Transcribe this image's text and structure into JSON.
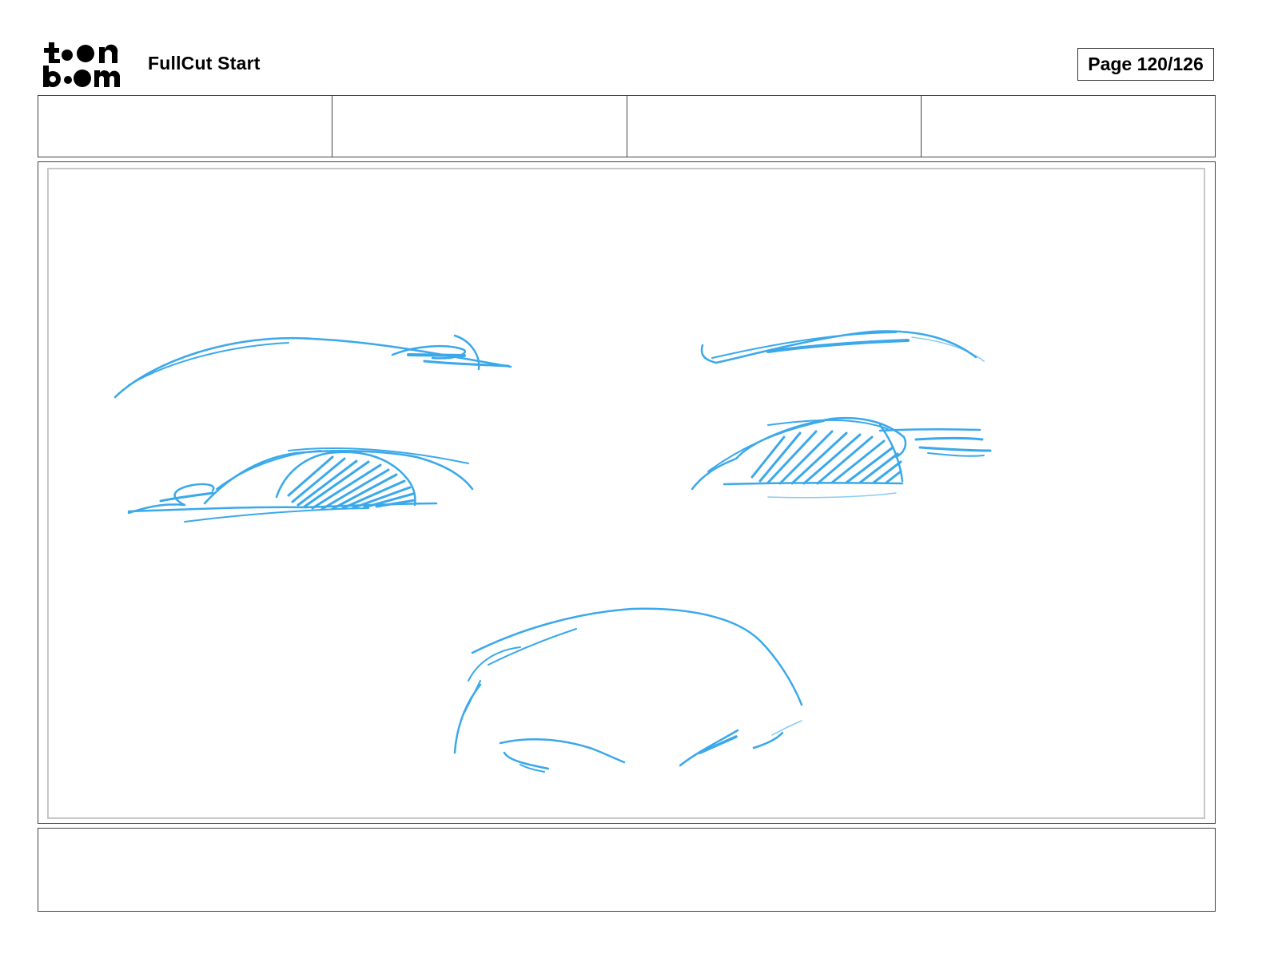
{
  "header": {
    "logo_text_top": "toon",
    "logo_text_bottom": "boom",
    "project_title": "FullCut Start",
    "page_label": "Page 120/126"
  },
  "info_row": {
    "cells": [
      "",
      "",
      "",
      ""
    ]
  },
  "panel": {
    "sketch_color": "#3aa8ea",
    "sketch_subject": "close-up face sketch: eyebrows, closed eyes, nose"
  },
  "caption": {
    "text": ""
  }
}
